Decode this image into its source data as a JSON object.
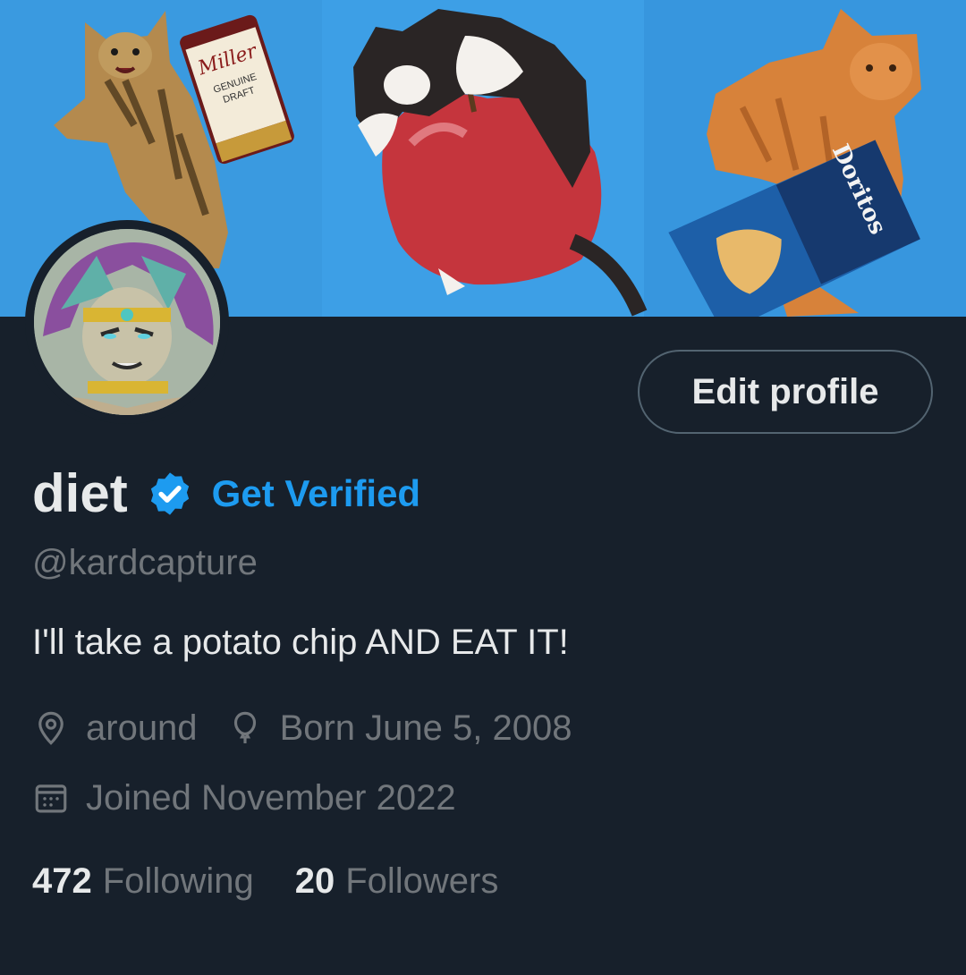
{
  "profile": {
    "display_name": "diet",
    "get_verified_label": "Get Verified",
    "handle": "@kardcapture",
    "bio": "I'll take a potato chip AND EAT IT!",
    "location": "around",
    "birthday": "Born June 5, 2008",
    "joined": "Joined November 2022"
  },
  "actions": {
    "edit_profile_label": "Edit profile"
  },
  "stats": {
    "following_count": "472",
    "following_label": "Following",
    "followers_count": "20",
    "followers_label": "Followers"
  },
  "banner": {
    "beer_brand": "Miller",
    "beer_line1": "GENUINE",
    "beer_line2": "DRAFT",
    "chips_brand": "Doritos"
  },
  "icons": {
    "verified": "verified-badge-icon",
    "location": "location-pin-icon",
    "birthday": "balloon-icon",
    "joined": "calendar-icon"
  },
  "colors": {
    "background": "#17202b",
    "accent": "#1d9bf0",
    "primary_text": "#e7e9ea",
    "secondary_text": "#71767b",
    "banner_sky": "#3b9be3"
  }
}
